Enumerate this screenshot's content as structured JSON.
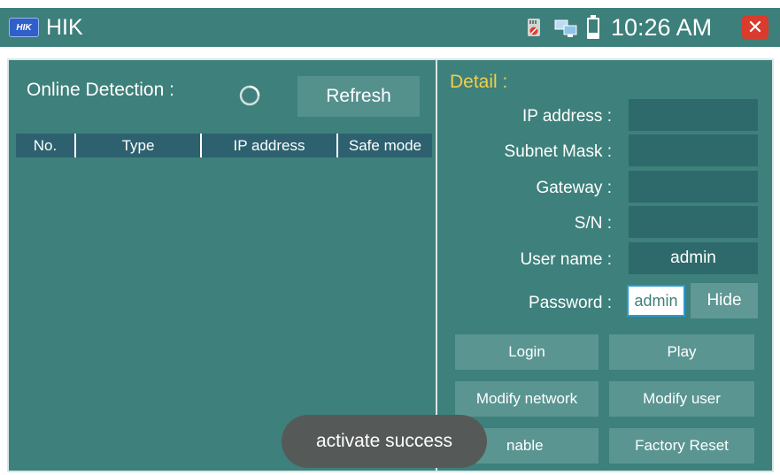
{
  "titlebar": {
    "logo_text": "HIK",
    "title": "HIK",
    "clock": "10:26 AM",
    "close_icon": "close-icon",
    "status_icons": [
      "sd-card-icon",
      "network-icon",
      "battery-icon"
    ]
  },
  "left_panel": {
    "online_label": "Online Detection :",
    "refresh_label": "Refresh",
    "columns": [
      "No.",
      "Type",
      "IP address",
      "Safe mode"
    ]
  },
  "detail": {
    "title": "Detail :",
    "ip_label": "IP address :",
    "ip_value": "",
    "subnet_label": "Subnet Mask :",
    "subnet_value": "",
    "gateway_label": "Gateway :",
    "gateway_value": "",
    "sn_label": "S/N :",
    "sn_value": "",
    "username_label": "User name :",
    "username_value": "admin",
    "password_label": "Password :",
    "password_value": "admin",
    "hide_label": "Hide"
  },
  "actions": {
    "login": "Login",
    "play": "Play",
    "modify_network": "Modify network",
    "modify_user": "Modify user",
    "enable": "nable",
    "factory_reset": "Factory Reset"
  },
  "toast": "activate success",
  "colors": {
    "background": "#3e807b",
    "titlebar": "#3d7f7a",
    "table_header": "#2d6170",
    "detail_title": "#f1cf4a",
    "close": "#d93b2c"
  }
}
